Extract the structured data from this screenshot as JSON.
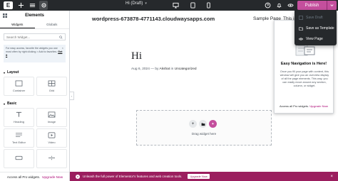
{
  "topbar": {
    "logo": "E",
    "title": "Hi (Draft)",
    "publish_label": "Publish"
  },
  "left_panel": {
    "heading": "Elements",
    "tabs": [
      "Widgets",
      "Globals"
    ],
    "search_placeholder": "Search Widget...",
    "tip": {
      "text": "For easy access, favorite the widgets you use most often by right clicking > Add to favorites.",
      "link": "Got it"
    },
    "categories": [
      {
        "name": "Layout",
        "widgets": [
          "Container",
          "Grid"
        ]
      },
      {
        "name": "Basic",
        "widgets": [
          "Heading",
          "Image",
          "Text Editor",
          "Video",
          "",
          ""
        ]
      }
    ],
    "footer": {
      "text": "Access all Pro widgets.",
      "link": "Upgrade Now"
    }
  },
  "canvas": {
    "site_title": "wordpress-673878-4771143.cloudwaysapps.com",
    "menu": [
      "Sample Page",
      "This is"
    ],
    "post_title": "Hi",
    "post_date": "Aug 6, 2024",
    "post_by": "by",
    "post_author": "Akshat",
    "post_in": "in",
    "post_category": "Uncategorized",
    "drop_label": "Drag widget here"
  },
  "banner": {
    "text": "Unleash the full power of Elementor's features and web creation tools.",
    "button": "Upgrade Now"
  },
  "navigator": {
    "heading": "Easy Navigation is Here!",
    "description": "Once you fill your page with content, this window will give you an overview display of all the page elements. This way, you can easily move around any section, column, or widget.",
    "footer_text": "Access all Pro widgets.",
    "footer_link": "Upgrade Now"
  },
  "publish_menu": {
    "items": [
      "Save Draft",
      "Save as Template",
      "View Page"
    ]
  },
  "colors": {
    "accent": "#c44f9d",
    "topbar": "#26292c",
    "banner": "#9b1e5e"
  }
}
